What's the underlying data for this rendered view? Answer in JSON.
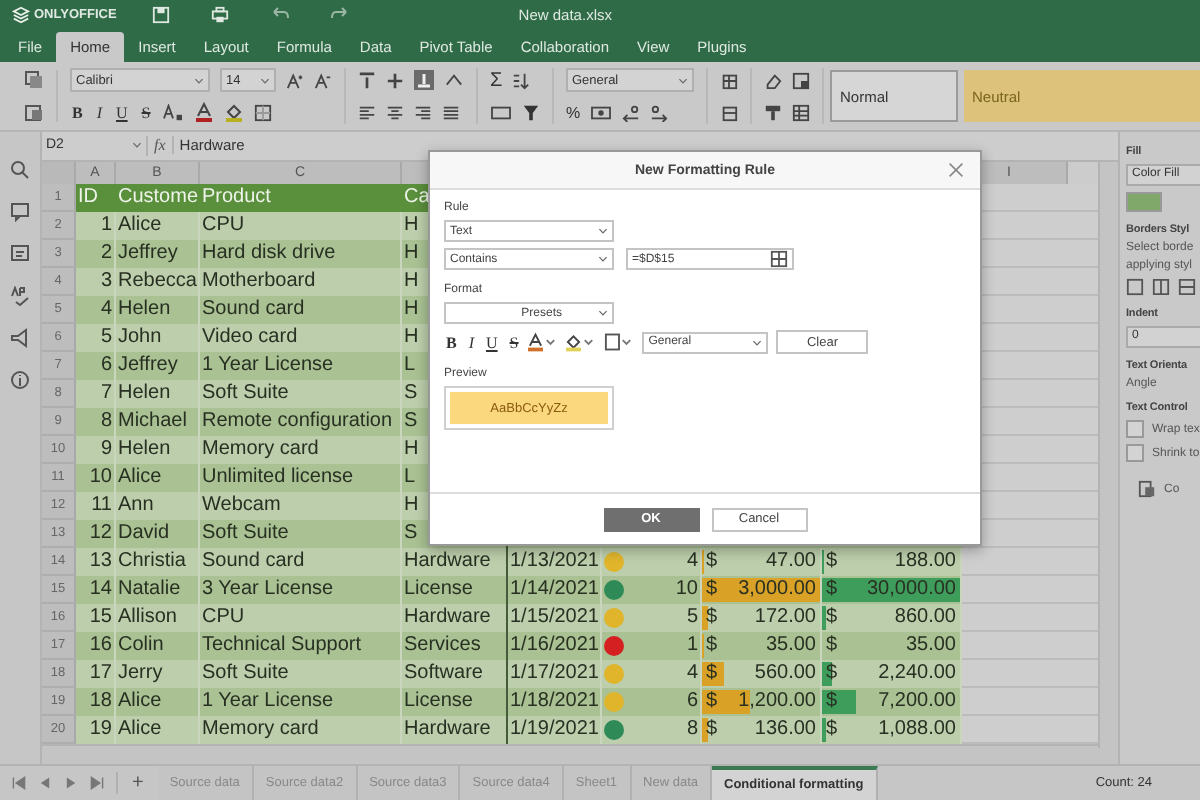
{
  "app": {
    "logo": "ONLYOFFICE",
    "title": "New data.xlsx"
  },
  "menu_tabs": [
    {
      "label": "File",
      "selected": false
    },
    {
      "label": "Home",
      "selected": true
    },
    {
      "label": "Insert",
      "selected": false
    },
    {
      "label": "Layout",
      "selected": false
    },
    {
      "label": "Formula",
      "selected": false
    },
    {
      "label": "Data",
      "selected": false
    },
    {
      "label": "Pivot Table",
      "selected": false
    },
    {
      "label": "Collaboration",
      "selected": false
    },
    {
      "label": "View",
      "selected": false
    },
    {
      "label": "Plugins",
      "selected": false
    }
  ],
  "toolbar": {
    "font_name": "Calibri",
    "font_size": "14",
    "text_styles": [
      "B",
      "I",
      "U",
      "S"
    ],
    "sum": "Σ",
    "number_format": "General",
    "percent": "%",
    "cell_styles": [
      {
        "label": "Normal",
        "color": "#d6d6d6"
      },
      {
        "label": "Neutral",
        "color": "#dcc27a"
      }
    ]
  },
  "formula_bar": {
    "cell_ref": "D2",
    "fx": "fx",
    "value": "Hardware"
  },
  "sheet": {
    "column_headers_left": [
      "A",
      "B",
      "C"
    ],
    "column_headers_right": [
      "I"
    ],
    "rows": [
      {
        "number": "1",
        "kind": "header",
        "cells": [
          "ID",
          "Custome",
          "Product",
          "Ca"
        ]
      },
      {
        "number": "2",
        "kind": "partial",
        "id": "1",
        "customer": "Alice",
        "product": "CPU",
        "category": "H"
      },
      {
        "number": "3",
        "kind": "partial",
        "id": "2",
        "customer": "Jeffrey",
        "product": "Hard disk drive",
        "category": "H"
      },
      {
        "number": "4",
        "kind": "partial",
        "id": "3",
        "customer": "Rebecca",
        "product": "Motherboard",
        "category": "H"
      },
      {
        "number": "5",
        "kind": "partial",
        "id": "4",
        "customer": "Helen",
        "product": "Sound card",
        "category": "H"
      },
      {
        "number": "6",
        "kind": "partial",
        "id": "5",
        "customer": "John",
        "product": "Video card",
        "category": "H"
      },
      {
        "number": "7",
        "kind": "partial",
        "id": "6",
        "customer": "Jeffrey",
        "product": "1 Year License",
        "category": "L"
      },
      {
        "number": "8",
        "kind": "partial",
        "id": "7",
        "customer": "Helen",
        "product": "Soft Suite",
        "category": "S"
      },
      {
        "number": "9",
        "kind": "partial",
        "id": "8",
        "customer": "Michael",
        "product": "Remote configuration",
        "category": "S"
      },
      {
        "number": "10",
        "kind": "partial",
        "id": "9",
        "customer": "Helen",
        "product": "Memory card",
        "category": "H"
      },
      {
        "number": "11",
        "kind": "partial",
        "id": "10",
        "customer": "Alice",
        "product": "Unlimited license",
        "category": "L"
      },
      {
        "number": "12",
        "kind": "partial",
        "id": "11",
        "customer": "Ann",
        "product": "Webcam",
        "category": "H"
      },
      {
        "number": "13",
        "kind": "partial",
        "id": "12",
        "customer": "David",
        "product": "Soft Suite",
        "category": "S"
      },
      {
        "number": "14",
        "kind": "full",
        "id": "13",
        "customer": "Christia",
        "product": "Sound card",
        "category": "Hardware",
        "date": "1/13/2021",
        "color": "#e0b52c",
        "qty": "4",
        "price": {
          "symbol": "$",
          "amount": "47.00",
          "level": 0.016
        },
        "total": {
          "symbol": "$",
          "amount": "188.00",
          "level": 0.006
        }
      },
      {
        "number": "15",
        "kind": "full",
        "id": "14",
        "customer": "Natalie",
        "product": "3 Year License",
        "category": "License",
        "date": "1/14/2021",
        "color": "#2e8b57",
        "qty": "10",
        "price": {
          "symbol": "$",
          "amount": "3,000.00",
          "level": 1
        },
        "total": {
          "symbol": "$",
          "amount": "30,000.00",
          "level": 1
        }
      },
      {
        "number": "16",
        "kind": "full",
        "id": "15",
        "customer": "Allison",
        "product": "CPU",
        "category": "Hardware",
        "date": "1/15/2021",
        "color": "#e0b52c",
        "qty": "5",
        "price": {
          "symbol": "$",
          "amount": "172.00",
          "level": 0.057
        },
        "total": {
          "symbol": "$",
          "amount": "860.00",
          "level": 0.029
        }
      },
      {
        "number": "17",
        "kind": "full",
        "id": "16",
        "customer": "Colin",
        "product": "Technical Support",
        "category": "Services",
        "date": "1/16/2021",
        "color": "#d42020",
        "qty": "1",
        "price": {
          "symbol": "$",
          "amount": "35.00",
          "level": 0.012
        },
        "total": {
          "symbol": "$",
          "amount": "35.00",
          "level": 0.001
        }
      },
      {
        "number": "18",
        "kind": "full",
        "id": "17",
        "customer": "Jerry",
        "product": "Soft Suite",
        "category": "Software",
        "date": "1/17/2021",
        "color": "#e0b52c",
        "qty": "4",
        "price": {
          "symbol": "$",
          "amount": "560.00",
          "level": 0.19
        },
        "total": {
          "symbol": "$",
          "amount": "2,240.00",
          "level": 0.075
        }
      },
      {
        "number": "19",
        "kind": "full",
        "id": "18",
        "customer": "Alice",
        "product": "1 Year License",
        "category": "License",
        "date": "1/18/2021",
        "color": "#e0b52c",
        "qty": "6",
        "price": {
          "symbol": "$",
          "amount": "1,200.00",
          "level": 0.4
        },
        "total": {
          "symbol": "$",
          "amount": "7,200.00",
          "level": 0.24
        }
      },
      {
        "number": "20",
        "kind": "full",
        "id": "19",
        "customer": "Alice",
        "product": "Memory card",
        "category": "Hardware",
        "date": "1/19/2021",
        "color": "#2e8b57",
        "qty": "8",
        "price": {
          "symbol": "$",
          "amount": "136.00",
          "level": 0.045
        },
        "total": {
          "symbol": "$",
          "amount": "1,088.00",
          "level": 0.036
        }
      }
    ]
  },
  "right_panel": {
    "fill_title": "Fill",
    "fill_select": "Color Fill",
    "borders_title": "Borders Styl",
    "borders_hint": "Select borde",
    "borders_hint2": "applying styl",
    "indent_title": "Indent",
    "indent_value": "0",
    "orientation_title": "Text Orienta",
    "angle_label": "Angle",
    "text_control_title": "Text Control",
    "checkboxes": [
      {
        "label": "Wrap tex",
        "checked": false
      },
      {
        "label": "Shrink to",
        "checked": false
      }
    ],
    "button": "Co"
  },
  "sheet_tabs": [
    {
      "label": "Source data",
      "selected": false
    },
    {
      "label": "Source data2",
      "selected": false
    },
    {
      "label": "Source data3",
      "selected": false
    },
    {
      "label": "Source data4",
      "selected": false
    },
    {
      "label": "Sheet1",
      "selected": false
    },
    {
      "label": "New data",
      "selected": false
    },
    {
      "label": "Conditional formatting",
      "selected": true
    }
  ],
  "add_sheet": "+",
  "status": "Count: 24",
  "dialog": {
    "title": "New Formatting Rule",
    "rule_label": "Rule",
    "rule_type": "Text",
    "condition": "Contains",
    "condition_value": "=$D$15",
    "format_label": "Format",
    "presets": "Presets",
    "text_styles": [
      "B",
      "I",
      "U",
      "S"
    ],
    "number_format": "General",
    "clear": "Clear",
    "preview_label": "Preview",
    "preview_text": "AaBbCcYyZz",
    "ok": "OK",
    "cancel": "Cancel"
  }
}
